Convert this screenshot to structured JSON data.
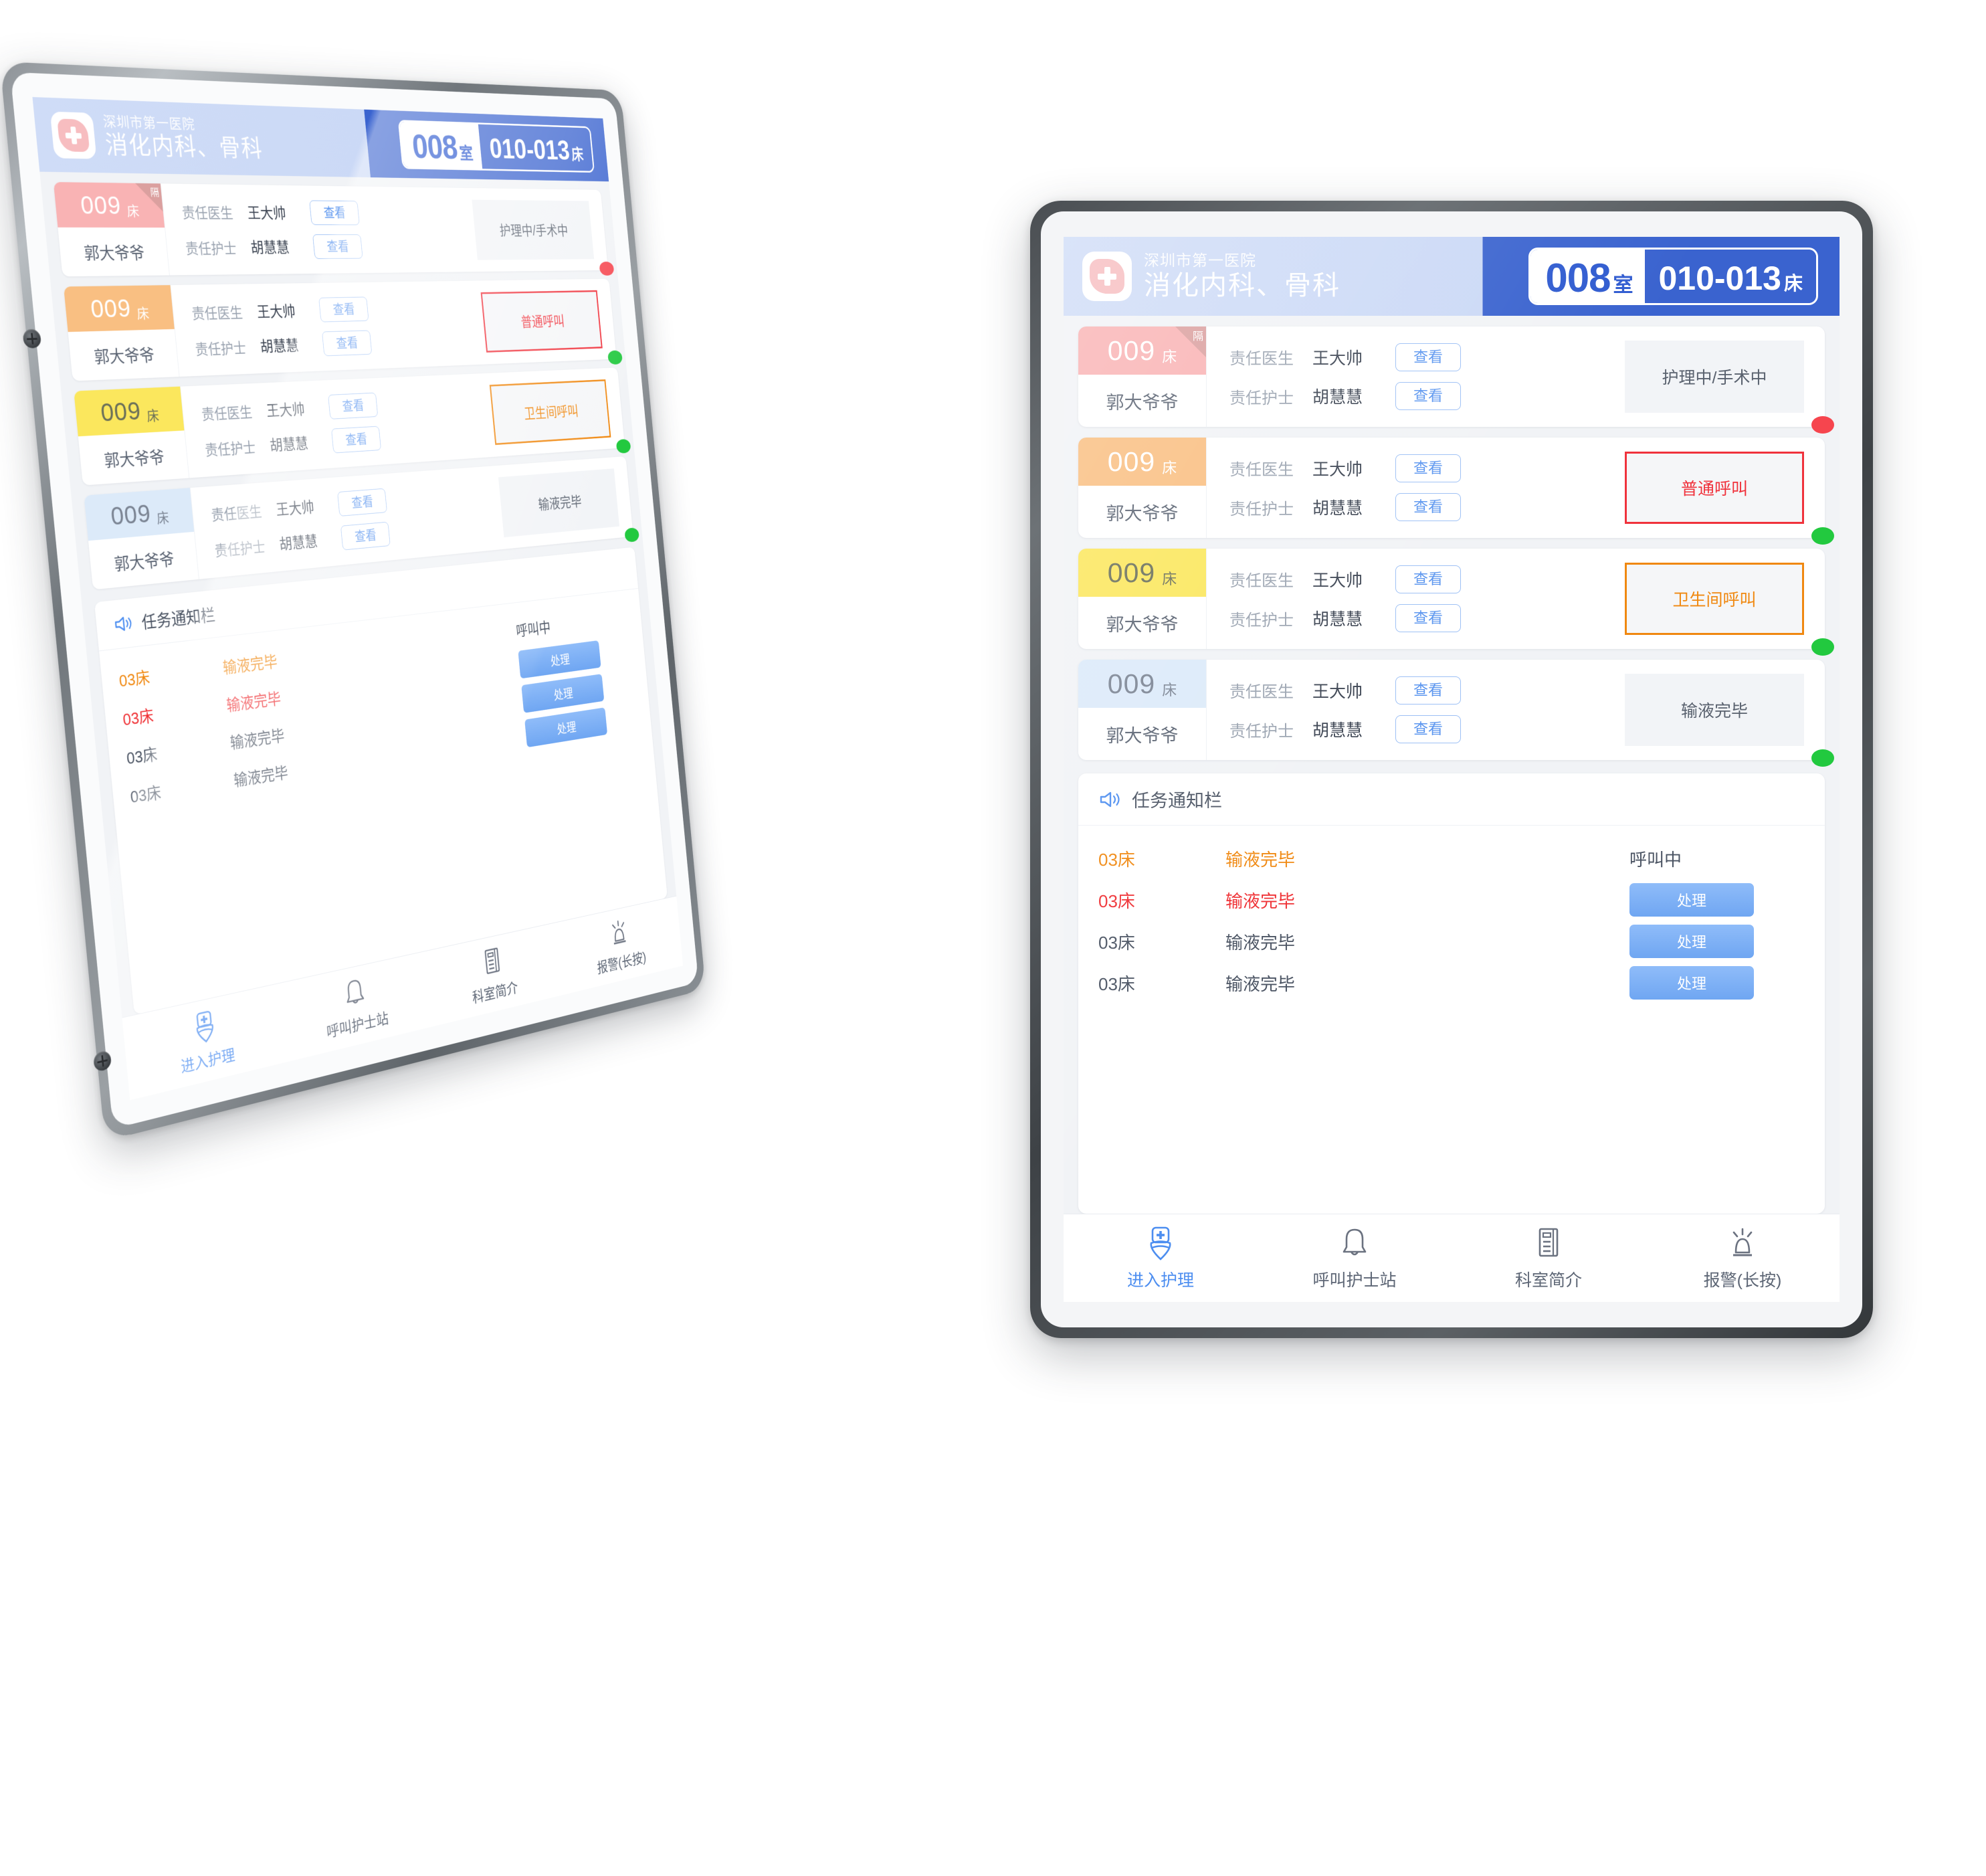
{
  "header": {
    "hospital_name": "深圳市第一医院",
    "department": "消化内科、骨科",
    "room_number": "008",
    "room_unit": "室",
    "bed_range": "010-013",
    "bed_unit": "床",
    "logo_icon": "hospital-cross-icon",
    "accent_blue": "#3a63cf",
    "header_left_bg": "#cbd9f6"
  },
  "labels": {
    "doctor_label": "责任医生",
    "nurse_label": "责任护士",
    "view_button": "查看",
    "bed_unit": "床",
    "iso_flag": "隔"
  },
  "patient_cards": [
    {
      "bed_number": "009",
      "bed_unit": "床",
      "patient_name": "郭大爷爷",
      "doctor_label": "责任医生",
      "doctor_name": "王大帅",
      "nurse_label": "责任护士",
      "nurse_name": "胡慧慧",
      "view_button": "查看",
      "status_text": "护理中/手术中",
      "status_style": "plain",
      "badge_color": "#f9b3b4",
      "badge_text_color": "#ffffff",
      "isolation": true,
      "isolation_flag": "隔",
      "dot_color": "red"
    },
    {
      "bed_number": "009",
      "bed_unit": "床",
      "patient_name": "郭大爷爷",
      "doctor_label": "责任医生",
      "doctor_name": "王大帅",
      "nurse_label": "责任护士",
      "nurse_name": "胡慧慧",
      "view_button": "查看",
      "status_text": "普通呼叫",
      "status_style": "red",
      "badge_color": "#f9bf82",
      "badge_text_color": "#ffffff",
      "isolation": false,
      "isolation_flag": "",
      "dot_color": "green"
    },
    {
      "bed_number": "009",
      "bed_unit": "床",
      "patient_name": "郭大爷爷",
      "doctor_label": "责任医生",
      "doctor_name": "王大帅",
      "nurse_label": "责任护士",
      "nurse_name": "胡慧慧",
      "view_button": "查看",
      "status_text": "卫生间呼叫",
      "status_style": "orange",
      "badge_color": "#fbe75d",
      "badge_text_color": "#6a6f59",
      "isolation": false,
      "isolation_flag": "",
      "dot_color": "green"
    },
    {
      "bed_number": "009",
      "bed_unit": "床",
      "patient_name": "郭大爷爷",
      "doctor_label": "责任医生",
      "doctor_name": "王大帅",
      "nurse_label": "责任护士",
      "nurse_name": "胡慧慧",
      "view_button": "查看",
      "status_text": "输液完毕",
      "status_style": "plain",
      "badge_color": "#dceaf9",
      "badge_text_color": "#7b8493",
      "isolation": false,
      "isolation_flag": "",
      "dot_color": "green"
    }
  ],
  "notify": {
    "title": "任务通知栏",
    "icon": "speaker-icon",
    "rows": [
      {
        "bed": "03床",
        "event": "输液完毕",
        "action_type": "status",
        "action_text": "呼叫中",
        "tone": "orange"
      },
      {
        "bed": "03床",
        "event": "输液完毕",
        "action_type": "button",
        "action_text": "处理",
        "tone": "red"
      },
      {
        "bed": "03床",
        "event": "输液完毕",
        "action_type": "button",
        "action_text": "处理",
        "tone": "gray"
      },
      {
        "bed": "03床",
        "event": "输液完毕",
        "action_type": "button",
        "action_text": "处理",
        "tone": "gray"
      }
    ]
  },
  "bottom_nav": {
    "items": [
      {
        "label": "进入护理",
        "icon": "nurse-cap-icon",
        "active": true
      },
      {
        "label": "呼叫护士站",
        "icon": "bell-icon",
        "active": false
      },
      {
        "label": "科室简介",
        "icon": "document-icon",
        "active": false
      },
      {
        "label": "报警(长按)",
        "icon": "alarm-light-icon",
        "active": false
      }
    ]
  }
}
